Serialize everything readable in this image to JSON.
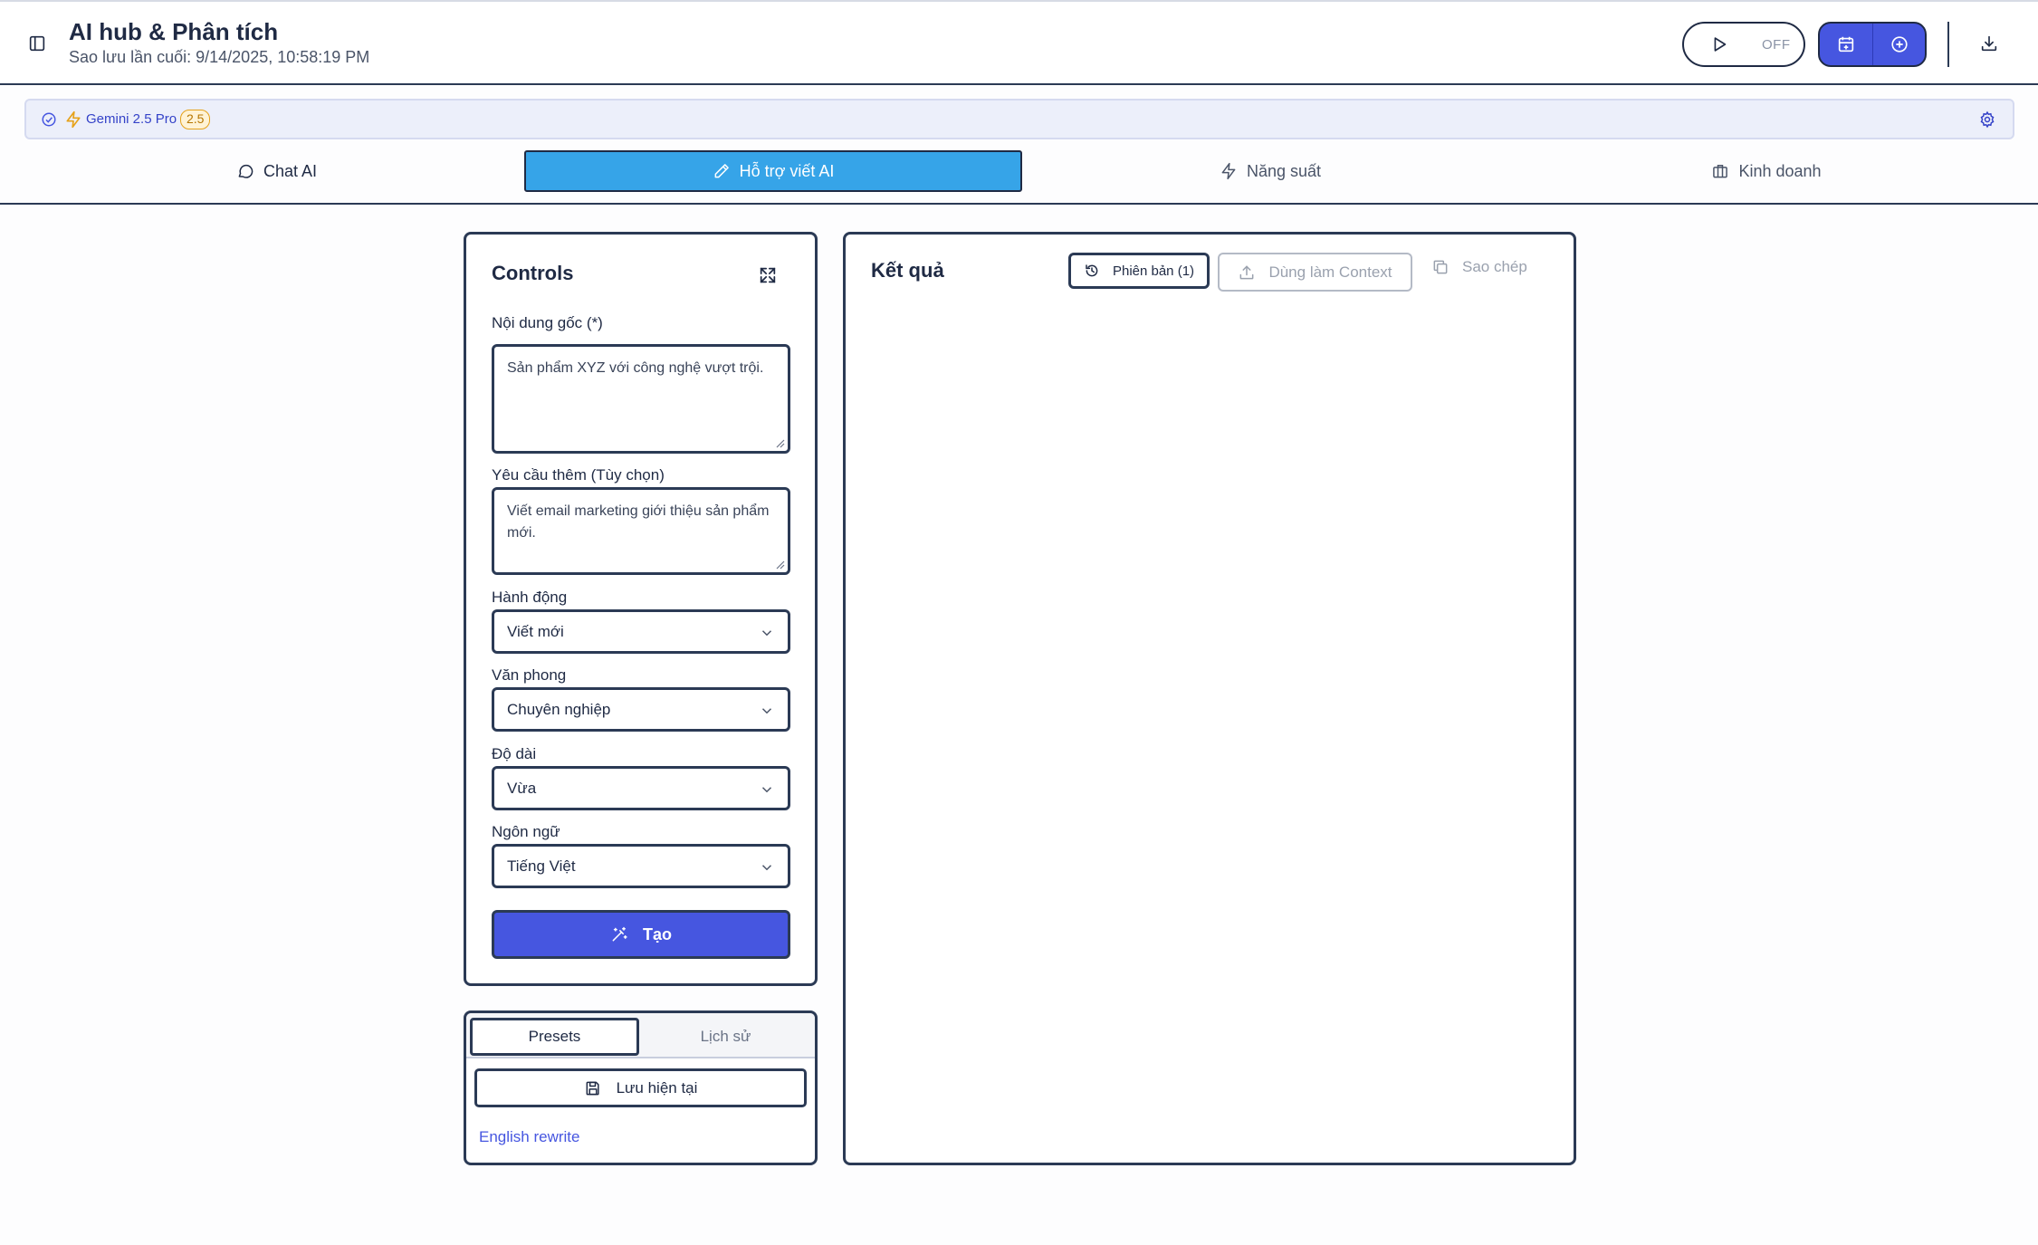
{
  "header": {
    "title": "AI hub & Phân tích",
    "subtitle": "Sao lưu lần cuối: 9/14/2025, 10:58:19 PM",
    "toggle_label": "OFF"
  },
  "model": {
    "name": "Gemini 2.5 Pro",
    "badge": "2.5"
  },
  "tabs": [
    {
      "label": "Chat AI",
      "icon": "chat-bubble-icon"
    },
    {
      "label": "Hỗ trợ viết AI",
      "icon": "pencil-icon"
    },
    {
      "label": "Năng suất",
      "icon": "lightning-icon"
    },
    {
      "label": "Kinh doanh",
      "icon": "briefcase-icon"
    }
  ],
  "controls": {
    "title": "Controls",
    "source_label": "Nội dung gốc (*)",
    "source_value": "Sản phẩm XYZ với công nghệ vượt trội.",
    "extra_label": "Yêu cầu thêm (Tùy chọn)",
    "extra_value": "Viết email marketing giới thiệu sản phẩm mới.",
    "action_label": "Hành động",
    "action_value": "Viết mới",
    "tone_label": "Văn phong",
    "tone_value": "Chuyên nghiệp",
    "length_label": "Độ dài",
    "length_value": "Vừa",
    "language_label": "Ngôn ngữ",
    "language_value": "Tiếng Việt",
    "create_label": "Tạo"
  },
  "presets": {
    "tab_presets": "Presets",
    "tab_history": "Lịch sử",
    "save_label": "Lưu hiện tại",
    "items": [
      "English rewrite"
    ]
  },
  "result": {
    "title": "Kết quả",
    "versions_label": "Phiên bản (1)",
    "context_label": "Dùng làm Context",
    "copy_label": "Sao chép"
  },
  "colors": {
    "accent": "#4656e0",
    "active_tab": "#36a4e8",
    "border": "#2b3a55",
    "badge": "#e6a21a"
  }
}
